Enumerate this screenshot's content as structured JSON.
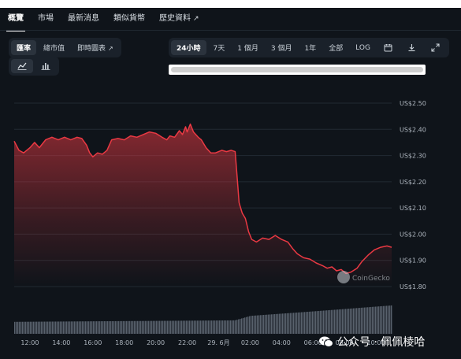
{
  "tabs": [
    {
      "label": "概覽",
      "active": true
    },
    {
      "label": "市場"
    },
    {
      "label": "最新消息"
    },
    {
      "label": "類似貨幣"
    },
    {
      "label": "歷史資料",
      "external": true
    }
  ],
  "view_toggle": {
    "items": [
      "匯率",
      "總市值",
      "即時圖表"
    ]
  },
  "range_toggle": {
    "items": [
      "24小時",
      "7天",
      "1 個月",
      "3 個月",
      "1年",
      "全部",
      "LOG"
    ]
  },
  "chart_type_toggle": {
    "icons": [
      "line-chart-icon",
      "bar-chart-icon"
    ]
  },
  "toolbar_icons": [
    "calendar-icon",
    "download-icon",
    "expand-icon"
  ],
  "coingecko_watermark": "CoinGecko",
  "page_watermark": "公众号 · 佩佩棱哈",
  "colors": {
    "line": "#ea3943",
    "background": "#0f141a",
    "volume": "#59626d"
  },
  "chart_data": {
    "type": "area",
    "y_ticks": [
      "US$2.50",
      "US$2.40",
      "US$2.30",
      "US$2.20",
      "US$2.10",
      "US$2.00",
      "US$1.90",
      "US$1.80"
    ],
    "ylim": [
      1.8,
      2.5
    ],
    "x_ticks": [
      "12:00",
      "14:00",
      "16:00",
      "18:00",
      "20:00",
      "22:00",
      "29. 6月",
      "02:00",
      "04:00",
      "06:00",
      "08:00",
      "10:00"
    ],
    "x_hours": [
      12,
      14,
      16,
      18,
      20,
      22,
      24,
      26,
      28,
      30,
      32,
      34
    ],
    "grid": true,
    "series": [
      {
        "points": [
          [
            11.0,
            2.355
          ],
          [
            11.3,
            2.32
          ],
          [
            11.6,
            2.31
          ],
          [
            12.0,
            2.33
          ],
          [
            12.3,
            2.35
          ],
          [
            12.6,
            2.33
          ],
          [
            13.0,
            2.36
          ],
          [
            13.4,
            2.37
          ],
          [
            13.8,
            2.36
          ],
          [
            14.2,
            2.37
          ],
          [
            14.6,
            2.36
          ],
          [
            15.0,
            2.37
          ],
          [
            15.3,
            2.365
          ],
          [
            15.6,
            2.34
          ],
          [
            15.8,
            2.31
          ],
          [
            16.0,
            2.295
          ],
          [
            16.3,
            2.31
          ],
          [
            16.6,
            2.305
          ],
          [
            16.9,
            2.32
          ],
          [
            17.2,
            2.36
          ],
          [
            17.6,
            2.365
          ],
          [
            18.0,
            2.36
          ],
          [
            18.4,
            2.375
          ],
          [
            18.8,
            2.37
          ],
          [
            19.2,
            2.38
          ],
          [
            19.6,
            2.39
          ],
          [
            20.0,
            2.385
          ],
          [
            20.4,
            2.37
          ],
          [
            20.7,
            2.36
          ],
          [
            20.9,
            2.375
          ],
          [
            21.2,
            2.37
          ],
          [
            21.5,
            2.395
          ],
          [
            21.7,
            2.38
          ],
          [
            21.9,
            2.41
          ],
          [
            22.0,
            2.39
          ],
          [
            22.2,
            2.42
          ],
          [
            22.4,
            2.39
          ],
          [
            22.7,
            2.37
          ],
          [
            22.9,
            2.36
          ],
          [
            23.2,
            2.33
          ],
          [
            23.5,
            2.31
          ],
          [
            23.8,
            2.31
          ],
          [
            24.2,
            2.32
          ],
          [
            24.5,
            2.315
          ],
          [
            24.8,
            2.32
          ],
          [
            25.05,
            2.315
          ],
          [
            25.2,
            2.2
          ],
          [
            25.3,
            2.12
          ],
          [
            25.5,
            2.08
          ],
          [
            25.7,
            2.06
          ],
          [
            25.9,
            2.01
          ],
          [
            26.1,
            1.98
          ],
          [
            26.4,
            1.97
          ],
          [
            26.8,
            1.985
          ],
          [
            27.2,
            1.98
          ],
          [
            27.6,
            1.995
          ],
          [
            28.0,
            1.98
          ],
          [
            28.4,
            1.97
          ],
          [
            28.7,
            1.945
          ],
          [
            29.0,
            1.925
          ],
          [
            29.4,
            1.91
          ],
          [
            29.8,
            1.905
          ],
          [
            30.2,
            1.89
          ],
          [
            30.6,
            1.88
          ],
          [
            30.9,
            1.87
          ],
          [
            31.2,
            1.875
          ],
          [
            31.5,
            1.86
          ],
          [
            31.8,
            1.865
          ],
          [
            32.1,
            1.85
          ],
          [
            32.4,
            1.855
          ],
          [
            32.8,
            1.87
          ],
          [
            33.1,
            1.895
          ],
          [
            33.5,
            1.92
          ],
          [
            33.9,
            1.94
          ],
          [
            34.3,
            1.95
          ],
          [
            34.7,
            1.955
          ],
          [
            35.0,
            1.95
          ]
        ]
      }
    ],
    "volume_level": [
      [
        11.0,
        0.4
      ],
      [
        25.0,
        0.45
      ],
      [
        26.0,
        0.6
      ],
      [
        30.0,
        0.75
      ],
      [
        35.0,
        0.95
      ]
    ]
  }
}
